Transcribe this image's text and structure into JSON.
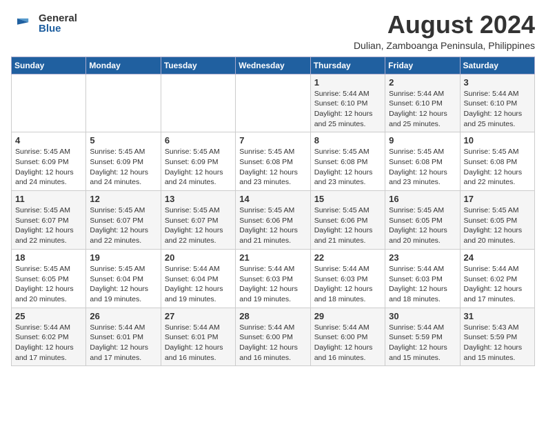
{
  "header": {
    "logo": {
      "general": "General",
      "blue": "Blue"
    },
    "month_year": "August 2024",
    "location": "Dulian, Zamboanga Peninsula, Philippines"
  },
  "calendar": {
    "weekdays": [
      "Sunday",
      "Monday",
      "Tuesday",
      "Wednesday",
      "Thursday",
      "Friday",
      "Saturday"
    ],
    "weeks": [
      [
        {
          "day": "",
          "info": ""
        },
        {
          "day": "",
          "info": ""
        },
        {
          "day": "",
          "info": ""
        },
        {
          "day": "",
          "info": ""
        },
        {
          "day": "1",
          "info": "Sunrise: 5:44 AM\nSunset: 6:10 PM\nDaylight: 12 hours\nand 25 minutes."
        },
        {
          "day": "2",
          "info": "Sunrise: 5:44 AM\nSunset: 6:10 PM\nDaylight: 12 hours\nand 25 minutes."
        },
        {
          "day": "3",
          "info": "Sunrise: 5:44 AM\nSunset: 6:10 PM\nDaylight: 12 hours\nand 25 minutes."
        }
      ],
      [
        {
          "day": "4",
          "info": "Sunrise: 5:45 AM\nSunset: 6:09 PM\nDaylight: 12 hours\nand 24 minutes."
        },
        {
          "day": "5",
          "info": "Sunrise: 5:45 AM\nSunset: 6:09 PM\nDaylight: 12 hours\nand 24 minutes."
        },
        {
          "day": "6",
          "info": "Sunrise: 5:45 AM\nSunset: 6:09 PM\nDaylight: 12 hours\nand 24 minutes."
        },
        {
          "day": "7",
          "info": "Sunrise: 5:45 AM\nSunset: 6:08 PM\nDaylight: 12 hours\nand 23 minutes."
        },
        {
          "day": "8",
          "info": "Sunrise: 5:45 AM\nSunset: 6:08 PM\nDaylight: 12 hours\nand 23 minutes."
        },
        {
          "day": "9",
          "info": "Sunrise: 5:45 AM\nSunset: 6:08 PM\nDaylight: 12 hours\nand 23 minutes."
        },
        {
          "day": "10",
          "info": "Sunrise: 5:45 AM\nSunset: 6:08 PM\nDaylight: 12 hours\nand 22 minutes."
        }
      ],
      [
        {
          "day": "11",
          "info": "Sunrise: 5:45 AM\nSunset: 6:07 PM\nDaylight: 12 hours\nand 22 minutes."
        },
        {
          "day": "12",
          "info": "Sunrise: 5:45 AM\nSunset: 6:07 PM\nDaylight: 12 hours\nand 22 minutes."
        },
        {
          "day": "13",
          "info": "Sunrise: 5:45 AM\nSunset: 6:07 PM\nDaylight: 12 hours\nand 22 minutes."
        },
        {
          "day": "14",
          "info": "Sunrise: 5:45 AM\nSunset: 6:06 PM\nDaylight: 12 hours\nand 21 minutes."
        },
        {
          "day": "15",
          "info": "Sunrise: 5:45 AM\nSunset: 6:06 PM\nDaylight: 12 hours\nand 21 minutes."
        },
        {
          "day": "16",
          "info": "Sunrise: 5:45 AM\nSunset: 6:05 PM\nDaylight: 12 hours\nand 20 minutes."
        },
        {
          "day": "17",
          "info": "Sunrise: 5:45 AM\nSunset: 6:05 PM\nDaylight: 12 hours\nand 20 minutes."
        }
      ],
      [
        {
          "day": "18",
          "info": "Sunrise: 5:45 AM\nSunset: 6:05 PM\nDaylight: 12 hours\nand 20 minutes."
        },
        {
          "day": "19",
          "info": "Sunrise: 5:45 AM\nSunset: 6:04 PM\nDaylight: 12 hours\nand 19 minutes."
        },
        {
          "day": "20",
          "info": "Sunrise: 5:44 AM\nSunset: 6:04 PM\nDaylight: 12 hours\nand 19 minutes."
        },
        {
          "day": "21",
          "info": "Sunrise: 5:44 AM\nSunset: 6:03 PM\nDaylight: 12 hours\nand 19 minutes."
        },
        {
          "day": "22",
          "info": "Sunrise: 5:44 AM\nSunset: 6:03 PM\nDaylight: 12 hours\nand 18 minutes."
        },
        {
          "day": "23",
          "info": "Sunrise: 5:44 AM\nSunset: 6:03 PM\nDaylight: 12 hours\nand 18 minutes."
        },
        {
          "day": "24",
          "info": "Sunrise: 5:44 AM\nSunset: 6:02 PM\nDaylight: 12 hours\nand 17 minutes."
        }
      ],
      [
        {
          "day": "25",
          "info": "Sunrise: 5:44 AM\nSunset: 6:02 PM\nDaylight: 12 hours\nand 17 minutes."
        },
        {
          "day": "26",
          "info": "Sunrise: 5:44 AM\nSunset: 6:01 PM\nDaylight: 12 hours\nand 17 minutes."
        },
        {
          "day": "27",
          "info": "Sunrise: 5:44 AM\nSunset: 6:01 PM\nDaylight: 12 hours\nand 16 minutes."
        },
        {
          "day": "28",
          "info": "Sunrise: 5:44 AM\nSunset: 6:00 PM\nDaylight: 12 hours\nand 16 minutes."
        },
        {
          "day": "29",
          "info": "Sunrise: 5:44 AM\nSunset: 6:00 PM\nDaylight: 12 hours\nand 16 minutes."
        },
        {
          "day": "30",
          "info": "Sunrise: 5:44 AM\nSunset: 5:59 PM\nDaylight: 12 hours\nand 15 minutes."
        },
        {
          "day": "31",
          "info": "Sunrise: 5:43 AM\nSunset: 5:59 PM\nDaylight: 12 hours\nand 15 minutes."
        }
      ]
    ]
  }
}
